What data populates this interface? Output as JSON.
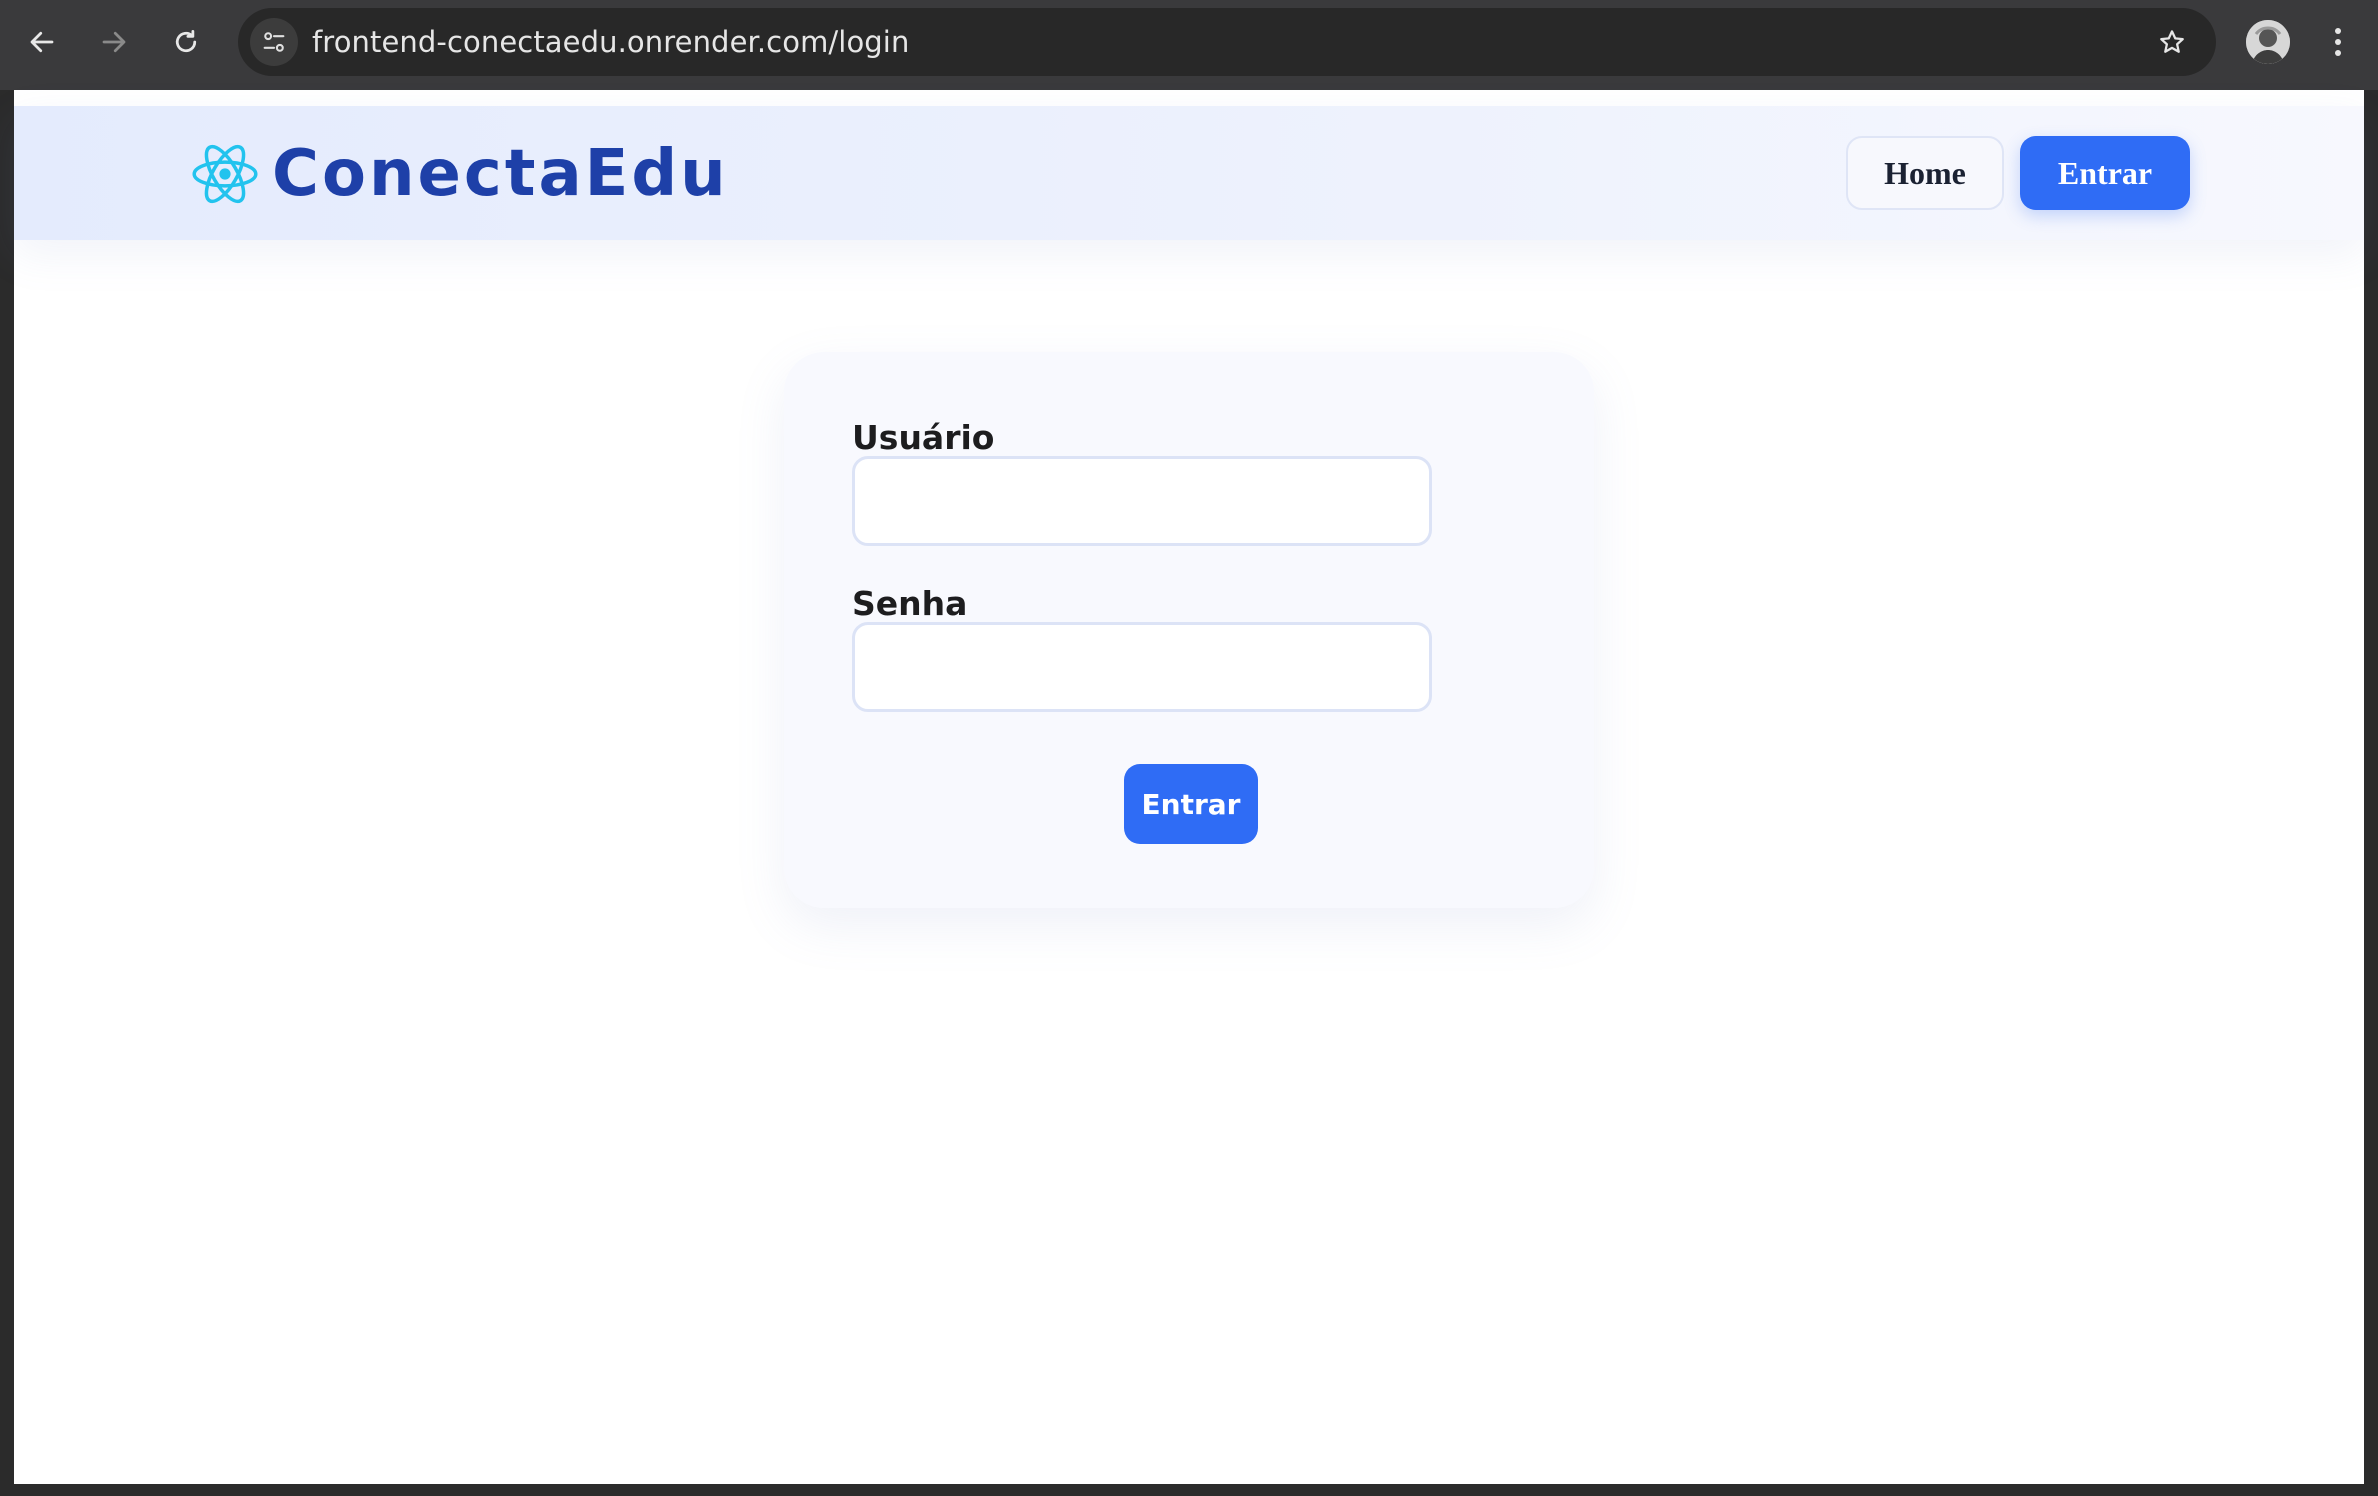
{
  "browser": {
    "url": "frontend-conectaedu.onrender.com/login",
    "icons": [
      "back-arrow-icon",
      "forward-arrow-icon",
      "reload-icon",
      "site-settings-icon",
      "bookmark-star-icon",
      "profile-avatar",
      "more-menu-icon"
    ]
  },
  "header": {
    "brand_name": "ConectaEdu",
    "brand_icon": "atom-icon",
    "nav": {
      "home_label": "Home",
      "enter_label": "Entrar"
    }
  },
  "login_form": {
    "username_label": "Usuário",
    "username_value": "",
    "password_label": "Senha",
    "password_value": "",
    "submit_label": "Entrar"
  },
  "colors": {
    "accent": "#2f6cf5",
    "brand_text": "#1e40a8",
    "atom": "#22c3ee",
    "header_bg": "#e4ebfd",
    "card_bg": "#f8f9fe"
  }
}
